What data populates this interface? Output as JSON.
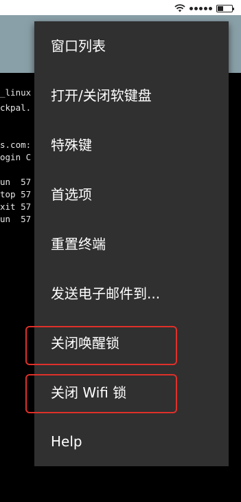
{
  "status_bar": {
    "wifi_icon": "wifi-icon",
    "signal_icon": "signal-dots-icon",
    "battery_icon": "battery-icon",
    "battery_level": 0.4
  },
  "terminal": {
    "lines": [
      "_linux",
      "ckpal.",
      "s.com:",
      "ogin C",
      "un  57",
      "top 57",
      "xit 57",
      "un  57"
    ]
  },
  "menu": {
    "items": [
      {
        "label": "窗口列表"
      },
      {
        "label": "打开/关闭软键盘"
      },
      {
        "label": "特殊键"
      },
      {
        "label": "首选项"
      },
      {
        "label": "重置终端"
      },
      {
        "label": "发送电子邮件到..."
      },
      {
        "label": "关闭唤醒锁"
      },
      {
        "label": "关闭 Wifi 锁"
      },
      {
        "label": "Help"
      }
    ]
  },
  "colors": {
    "menu_background": "#303030",
    "app_bar": "#8aa0a8",
    "highlight": "#e0302a"
  }
}
